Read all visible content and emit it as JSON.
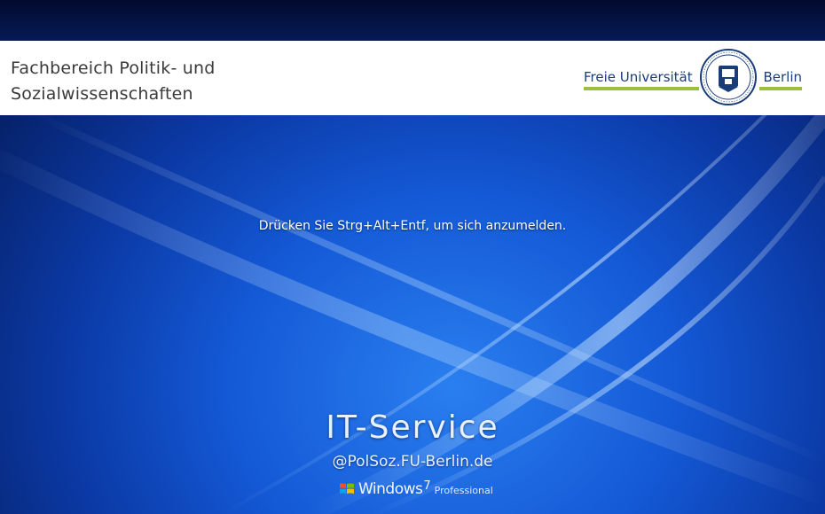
{
  "header": {
    "department_line1": "Fachbereich Politik- und",
    "department_line2": "Sozialwissenschaften",
    "logo_left": "Freie Universität",
    "logo_right": "Berlin",
    "logo_accent": "#9bc13c",
    "logo_color": "#1a3d7a"
  },
  "login": {
    "prompt": "Drücken Sie Strg+Alt+Entf, um sich anzumelden."
  },
  "branding": {
    "service_title": "IT-Service",
    "service_domain": "@PolSoz.FU-Berlin.de",
    "os_name": "Windows",
    "os_version": "7",
    "os_edition": "Professional",
    "os_icon": "windows-flag-icon"
  },
  "colors": {
    "background_dark": "#041447",
    "background_mid": "#1459d6",
    "background_light": "#2a7ff0"
  }
}
